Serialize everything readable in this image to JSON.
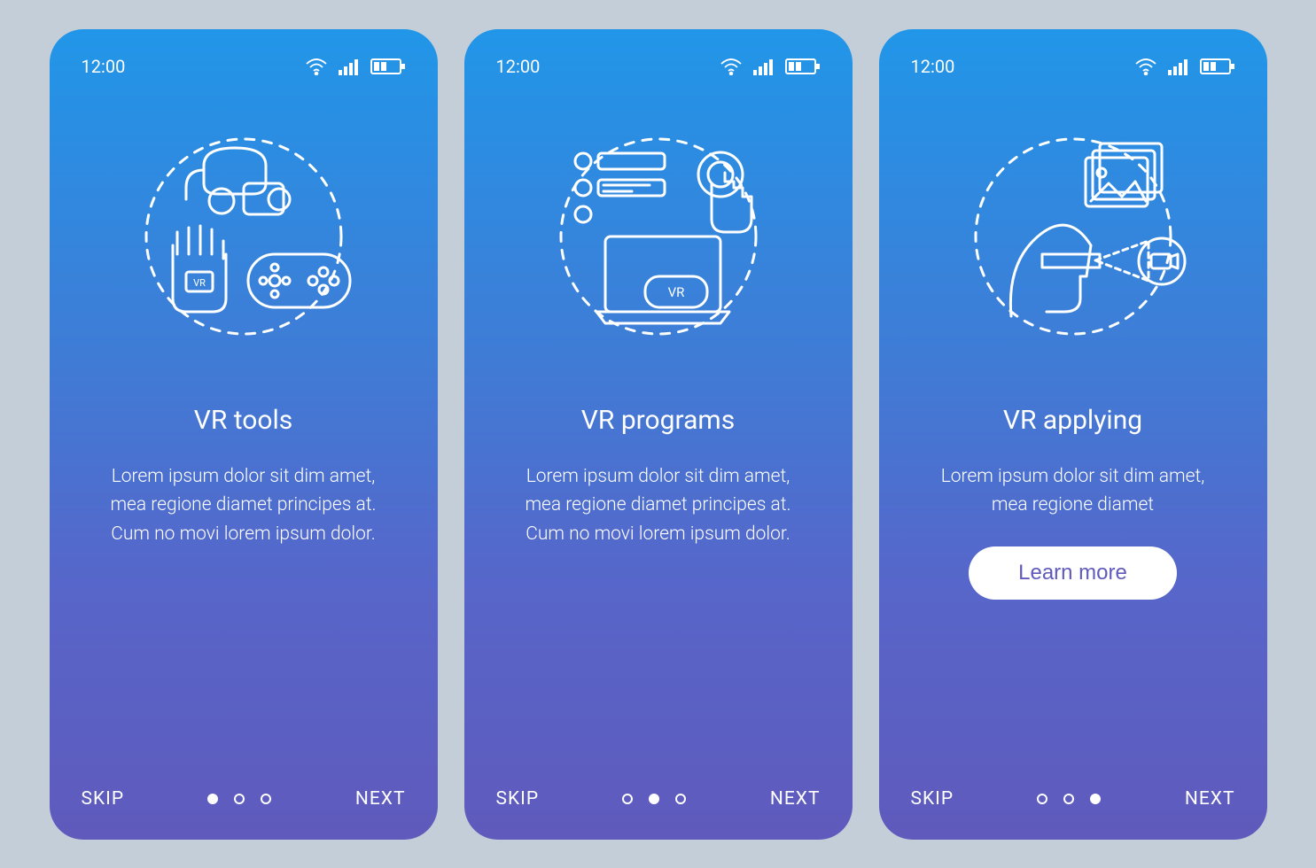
{
  "status": {
    "time": "12:00"
  },
  "screens": [
    {
      "title": "VR tools",
      "body": "Lorem ipsum dolor sit dim amet, mea regione diamet principes at. Cum no movi lorem ipsum dolor.",
      "skip": "SKIP",
      "next": "NEXT",
      "activeDot": 0,
      "cta": null
    },
    {
      "title": "VR programs",
      "body": "Lorem ipsum dolor sit dim amet, mea regione diamet principes at. Cum no movi lorem ipsum dolor.",
      "skip": "SKIP",
      "next": "NEXT",
      "activeDot": 1,
      "cta": null
    },
    {
      "title": "VR applying",
      "body": "Lorem ipsum dolor sit dim amet, mea regione diamet",
      "skip": "SKIP",
      "next": "NEXT",
      "activeDot": 2,
      "cta": "Learn more"
    }
  ]
}
